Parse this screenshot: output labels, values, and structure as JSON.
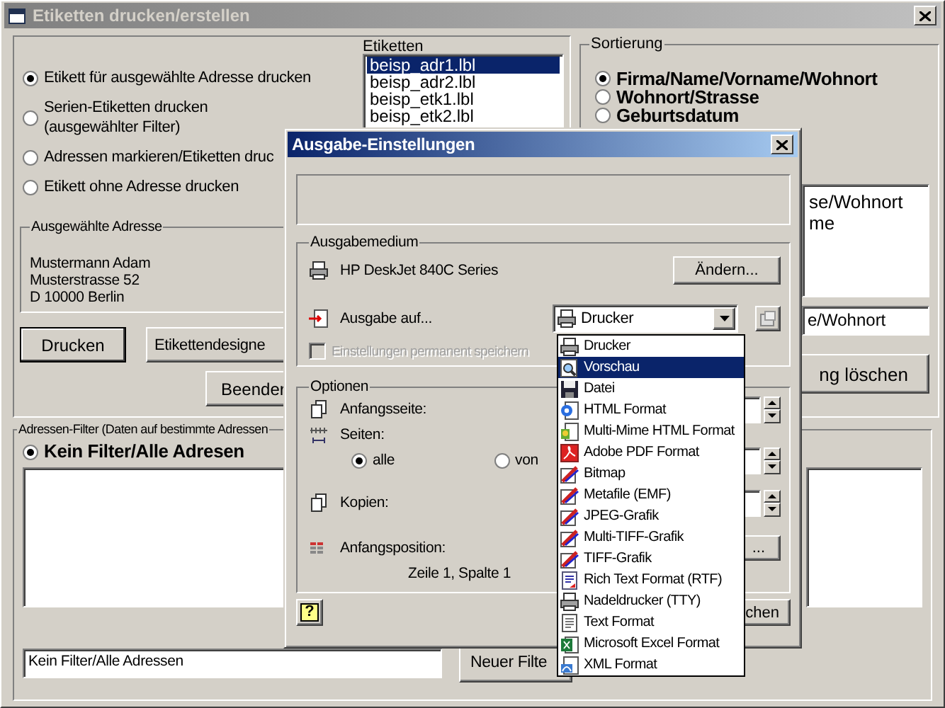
{
  "main_window": {
    "title": "Etiketten drucken/erstellen",
    "print_options": [
      {
        "label": "Etikett für ausgewählte Adresse drucken",
        "selected": true
      },
      {
        "label": "Serien-Etiketten drucken\n(ausgewählter Filter)",
        "selected": false
      },
      {
        "label": "Adressen markieren/Etiketten druc",
        "selected": false
      },
      {
        "label": "Etikett ohne Adresse drucken",
        "selected": false
      }
    ],
    "address_group": {
      "title": "Ausgewählte Adresse",
      "lines": [
        "Mustermann Adam",
        "Musterstrasse 52",
        "D 10000 Berlin"
      ]
    },
    "buttons": [
      "Drucken",
      "Etikettendesigne",
      "Beender"
    ],
    "labels": {
      "title": "Etiketten",
      "items": [
        {
          "text": "beisp_adr1.lbl",
          "selected": true
        },
        {
          "text": "beisp_adr2.lbl",
          "selected": false
        },
        {
          "text": "beisp_etk1.lbl",
          "selected": false
        },
        {
          "text": "beisp_etk2.lbl",
          "selected": false
        }
      ]
    },
    "sorting": {
      "title": "Sortierung",
      "options": [
        {
          "label": "Firma/Name/Vorname/Wohnort",
          "selected": true
        },
        {
          "label": "Wohnort/Strasse",
          "selected": false
        },
        {
          "label": "Geburtsdatum",
          "selected": false
        }
      ],
      "list_items": [
        "se/Wohnort",
        "me"
      ],
      "field_value": "e/Wohnort",
      "button": "ng löschen"
    },
    "filter": {
      "title": "Adressen-Filter (Daten auf bestimmte Adressen",
      "options": [
        {
          "label": "Kein Filter/Alle Adresen",
          "selected": true
        }
      ],
      "field_value": "Kein Filter/Alle Adressen",
      "button": "Neuer Filte"
    }
  },
  "dialog": {
    "title": "Ausgabe-Einstellungen",
    "output_medium": {
      "title": "Ausgabemedium",
      "printer": "HP DeskJet 840C Series",
      "change_button": "Ändern...",
      "output_label": "Ausgabe auf...",
      "output_value": "Drucker",
      "save_checkbox": {
        "label": "Einstellungen permanent speichern",
        "checked": false,
        "disabled": true
      }
    },
    "options": {
      "title": "Optionen",
      "start_page_label": "Anfangsseite:",
      "pages_label": "Seiten:",
      "page_choices": [
        {
          "label": "alle",
          "selected": true
        },
        {
          "label": "von",
          "selected": false
        }
      ],
      "copies_label": "Kopien:",
      "start_position_label": "Anfangsposition:",
      "start_position_value": "Zeile 1, Spalte 1",
      "position_button": "..."
    },
    "help_button": "?",
    "cancel_button": "chen"
  },
  "dropdown": {
    "items": [
      {
        "label": "Drucker",
        "kind": "printer",
        "selected": false
      },
      {
        "label": "Vorschau",
        "kind": "preview",
        "selected": true
      },
      {
        "label": "Datei",
        "kind": "disk",
        "selected": false
      },
      {
        "label": "HTML Format",
        "kind": "html",
        "selected": false
      },
      {
        "label": "Multi-Mime HTML Format",
        "kind": "mime",
        "selected": false
      },
      {
        "label": "Adobe PDF Format",
        "kind": "pdf",
        "selected": false
      },
      {
        "label": "Bitmap",
        "kind": "image",
        "selected": false
      },
      {
        "label": "Metafile (EMF)",
        "kind": "image",
        "selected": false
      },
      {
        "label": "JPEG-Grafik",
        "kind": "image",
        "selected": false
      },
      {
        "label": "Multi-TIFF-Grafik",
        "kind": "image",
        "selected": false
      },
      {
        "label": "TIFF-Grafik",
        "kind": "image",
        "selected": false
      },
      {
        "label": "Rich Text Format (RTF)",
        "kind": "rtf",
        "selected": false
      },
      {
        "label": "Nadeldrucker (TTY)",
        "kind": "printer",
        "selected": false
      },
      {
        "label": "Text Format",
        "kind": "text",
        "selected": false
      },
      {
        "label": "Microsoft Excel Format",
        "kind": "excel",
        "selected": false
      },
      {
        "label": "XML Format",
        "kind": "xml",
        "selected": false
      }
    ]
  }
}
